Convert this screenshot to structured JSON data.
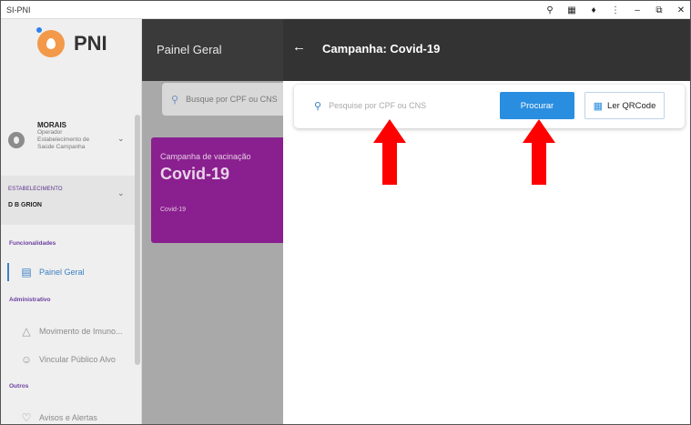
{
  "window": {
    "title": "SI-PNI",
    "controls": [
      "key-icon",
      "extension-icon",
      "puzzle-icon",
      "more-icon",
      "minimize",
      "restore",
      "close"
    ]
  },
  "sidebar": {
    "logo_text": "PNI",
    "user": {
      "name": "MORAIS",
      "role_lines": [
        "Operador",
        "Estabelecimento de",
        "Saúde Campanha"
      ]
    },
    "estab": {
      "label": "ESTABELECIMENTO",
      "value": "D B GRION"
    },
    "sections": {
      "funcionalidades": "Funcionalidades",
      "administrativo": "Administrativo",
      "outros": "Outros"
    },
    "items": [
      {
        "label": "Painel Geral",
        "icon": "monitor-icon",
        "active": true
      },
      {
        "label": "Movimento de Imuno...",
        "icon": "flask-icon",
        "active": false
      },
      {
        "label": "Vincular Público Alvo",
        "icon": "user-icon",
        "active": false
      },
      {
        "label": "Avisos e Alertas",
        "icon": "bell-icon",
        "active": false
      }
    ]
  },
  "main": {
    "title": "Painel Geral",
    "search_placeholder": "Busque por CPF ou CNS",
    "card": {
      "subtitle": "Campanha de vacinação",
      "title": "Covid-19",
      "small": "Covid-19"
    }
  },
  "panel": {
    "title": "Campanha: Covid-19",
    "search_placeholder": "Pesquise por CPF ou CNS",
    "search_value": "",
    "search_button": "Procurar",
    "qr_button": "Ler QRCode"
  },
  "colors": {
    "accent": "#2a8ee0",
    "header_dark": "#333333",
    "card_purple": "#8a1f8f",
    "arrow_red": "#ff0000",
    "section_purple": "#6b3fa0"
  }
}
